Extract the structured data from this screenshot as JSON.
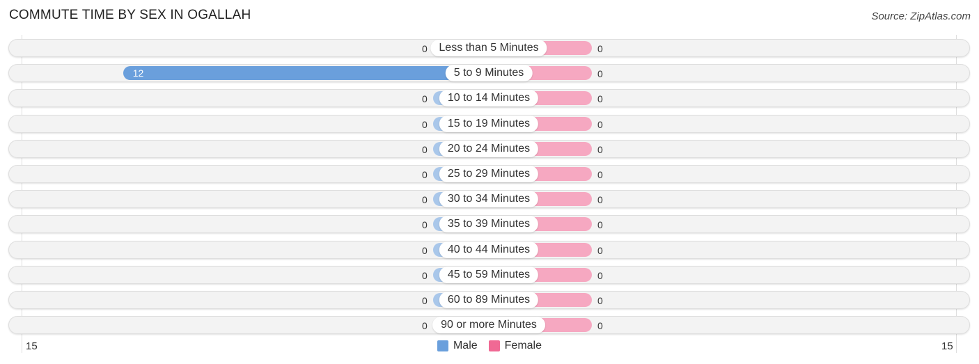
{
  "title": "COMMUTE TIME BY SEX IN OGALLAH",
  "source": "Source: ZipAtlas.com",
  "colors": {
    "male_strong": "#6a9fdc",
    "male_light": "#a9c7ea",
    "female_strong": "#f06994",
    "female_light": "#f6a8c1"
  },
  "chart_data": {
    "type": "bar",
    "orientation": "horizontal-diverging",
    "title": "COMMUTE TIME BY SEX IN OGALLAH",
    "categories": [
      "Less than 5 Minutes",
      "5 to 9 Minutes",
      "10 to 14 Minutes",
      "15 to 19 Minutes",
      "20 to 24 Minutes",
      "25 to 29 Minutes",
      "30 to 34 Minutes",
      "35 to 39 Minutes",
      "40 to 44 Minutes",
      "45 to 59 Minutes",
      "60 to 89 Minutes",
      "90 or more Minutes"
    ],
    "series": [
      {
        "name": "Male",
        "values": [
          0,
          12,
          0,
          0,
          0,
          0,
          0,
          0,
          0,
          0,
          0,
          0
        ]
      },
      {
        "name": "Female",
        "values": [
          0,
          0,
          0,
          0,
          0,
          0,
          0,
          0,
          0,
          0,
          0,
          0
        ]
      }
    ],
    "axis_min_label": "15",
    "axis_max_label": "15",
    "xlim": [
      -15,
      15
    ],
    "legend": {
      "position": "bottom-center",
      "entries": [
        "Male",
        "Female"
      ]
    }
  }
}
